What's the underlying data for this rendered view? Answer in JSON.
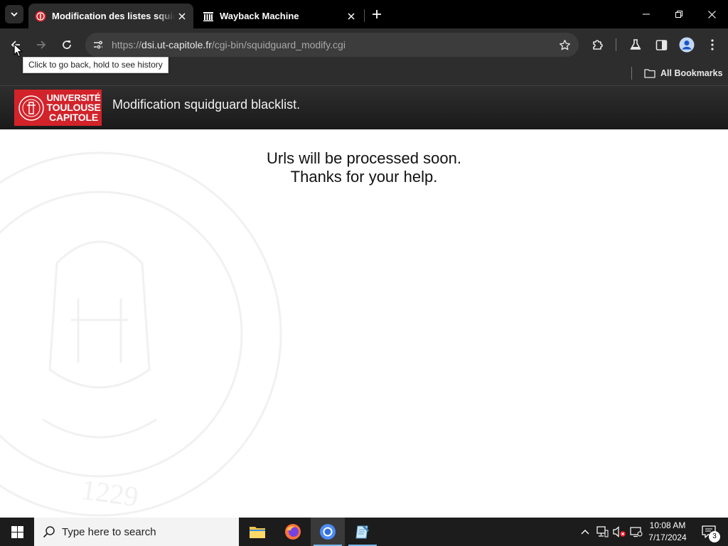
{
  "browser": {
    "tabs": [
      {
        "title": "Modification des listes squidguard",
        "active": true
      },
      {
        "title": "Wayback Machine",
        "active": false
      }
    ],
    "url_prefix": "https://",
    "url_host": "dsi.ut-capitole.fr",
    "url_path": "/cgi-bin/squidguard_modify.cgi",
    "tooltip": "Click to go back, hold to see history",
    "all_bookmarks": "All Bookmarks"
  },
  "page": {
    "logo_lines": [
      "UNIVERSITÉ",
      "TOULOUSE",
      "CAPITOLE"
    ],
    "header_title": "Modification squidguard blacklist.",
    "message_line1": "Urls will be processed soon.",
    "message_line2": "Thanks for your help.",
    "watermark_year": "1229"
  },
  "taskbar": {
    "search_placeholder": "Type here to search",
    "time": "10:08 AM",
    "date": "7/17/2024",
    "notification_count": "3"
  },
  "colors": {
    "brand_red": "#d2232a",
    "tab_strip": "#000000",
    "toolbar": "#2d2d2d",
    "header": "#262626"
  }
}
